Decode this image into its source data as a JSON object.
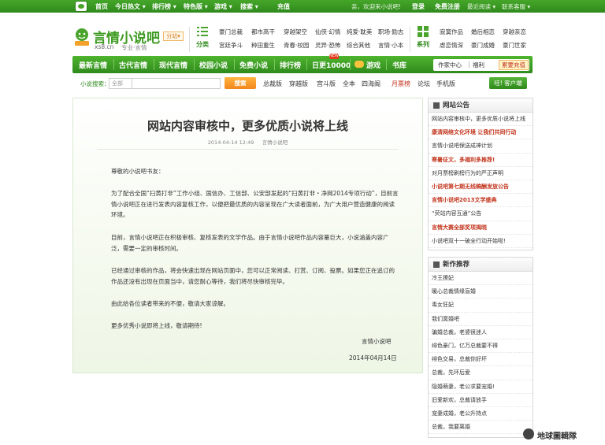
{
  "topbar": {
    "items": [
      "首页",
      "今日热文 ▾",
      "排行榜 ▾",
      "特色版 ▾",
      "游戏 ▾",
      "搜索 ▾",
      "充值"
    ],
    "greeting": "亲，欢迎来小说吧!",
    "login": "登录",
    "register": "免费注册",
    "recent": "最近阅读 ▾",
    "contact": "联系客服 ▾"
  },
  "header": {
    "brand_name": "言情小说吧",
    "brand_domain": "xs8.cn",
    "brand_sub": "专业·言情",
    "fenzhan": "分站▾",
    "categories_label": "分类",
    "categories": [
      [
        "豪门总裁",
        "都市高干",
        "穿越架空",
        "仙侠·幻情",
        "纯爱·耽美",
        "职场·励志"
      ],
      [
        "宫廷争斗",
        "种田重生",
        "青春·校园",
        "灵异·恐怖",
        "综合其他",
        "言情·小本"
      ]
    ],
    "series_label": "系列",
    "series": [
      [
        "寂寞作品",
        "婚后相恋",
        "穿越亲恋"
      ],
      [
        "虐恋情深",
        "豪门成婚",
        "豪门世家"
      ]
    ]
  },
  "mainnav": {
    "items": [
      "最新言情",
      "古代言情",
      "现代言情",
      "校园小说",
      "免费小说",
      "排行榜",
      "日更10000",
      "游戏",
      "书库"
    ],
    "new_badge": "NEW",
    "author_center": "作家中心",
    "welfare": "福利",
    "recharge": "累要充值"
  },
  "search": {
    "label": "小说搜索：",
    "select": "全部",
    "button": "搜索",
    "quick": [
      "总裁版",
      "穿越版",
      "宫斗版",
      "全本",
      "四海阁",
      "月票榜",
      "论坛",
      "手机版"
    ],
    "download": "哇! 客户端"
  },
  "article": {
    "title": "网站内容审核中，更多优质小说将上线",
    "date": "2014-04-14 12:49",
    "source": "言情小说吧",
    "greeting": "尊敬的小说吧书友：",
    "paragraphs": [
      "为了配合全国“扫黄打非”工作小组、国信办、工信部、公安部发起的“扫黄打非・净网2014专项行动”，目前言情小说吧正在进行发表内容复核工作，以便把最优质的内容呈现在广大读者面前，为广大用户营造健康的阅读环境。",
      "目前，言情小说吧正在积极审核、复核发表的文学作品。由于言情小说吧作品内容量巨大，小说涵盖内容广泛，需要一定的审核时间。",
      "已经通过审核的作品，将会快速出现在网站页面中，您可以正常阅读、打赏、订阅、投票。如果您正在追订的作品还没有出现在页面当中，请您耐心等待，我们将尽快审核完毕。",
      "由此给各位读者带来的不便，敬请大家谅解。",
      "更多优秀小说即将上线，敬请期待!"
    ],
    "signature": "言情小说吧",
    "sign_date": "2014年04月14日"
  },
  "announcements": {
    "title": "网站公告",
    "items": [
      {
        "text": "网站内容审核中，更多优质小说将上线",
        "red": false
      },
      {
        "text": "康清网络文化环境 让我们共同行动",
        "red": true
      },
      {
        "text": "言情小说吧保送成神计划",
        "red": false
      },
      {
        "text": "寒暑征文，多福利多推荐!",
        "red": true
      },
      {
        "text": "对月票榜刷榜行为的严正声明",
        "red": false
      },
      {
        "text": "小说吧第七期无线稿酬发放公告",
        "red": true
      },
      {
        "text": "言情小说吧2013文学盛典",
        "red": true
      },
      {
        "text": "“荧站内容互通”公告",
        "red": false
      },
      {
        "text": "言情大赛全部奖项揭晓",
        "red": true
      },
      {
        "text": "小说吧双十一破全行动开始啦!",
        "red": false
      }
    ]
  },
  "new_books": {
    "title": "新作推荐",
    "items": [
      "冷王撩妃",
      "暖心总裁情缘盲婚",
      "毒女狂妃",
      "我们寞婚吧",
      "骗婚总裁，老婆很迷人",
      "绯色豪门，亿万总裁要不得",
      "绯色交易，总裁你好坏",
      "总裁，先环后爱",
      "隐婚萌妻，老公求要宠婚!",
      "旧爱新欢，总裁请放手",
      "宠妻成婚，老公升持点",
      "总裁，我要离婚"
    ]
  },
  "watermark": "地球圖輯隊"
}
